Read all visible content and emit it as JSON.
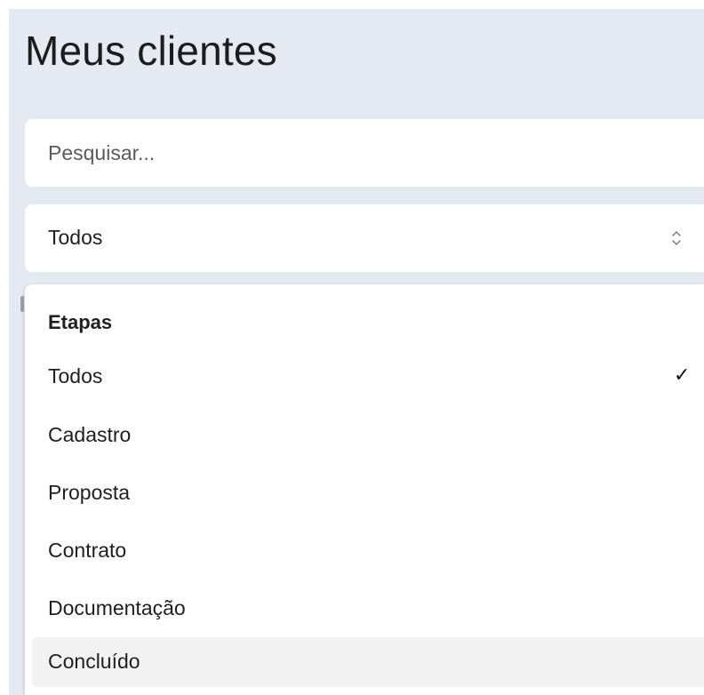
{
  "page": {
    "title": "Meus clientes"
  },
  "search": {
    "placeholder": "Pesquisar..."
  },
  "filter": {
    "selected_value": "Todos",
    "icon": "chevron-up-down-icon"
  },
  "dropdown": {
    "group_label": "Etapas",
    "options": [
      {
        "label": "Todos",
        "checked": true
      },
      {
        "label": "Cadastro",
        "checked": false
      },
      {
        "label": "Proposta",
        "checked": false
      },
      {
        "label": "Contrato",
        "checked": false
      },
      {
        "label": "Documentação",
        "checked": false
      },
      {
        "label": "Concluído",
        "checked": false,
        "highlighted": true
      }
    ],
    "check_glyph": "✓"
  },
  "colors": {
    "page_background": "#e5e9f2",
    "surface": "#ffffff",
    "highlight": "#f2f2f2",
    "text": "#1f1f1f"
  }
}
